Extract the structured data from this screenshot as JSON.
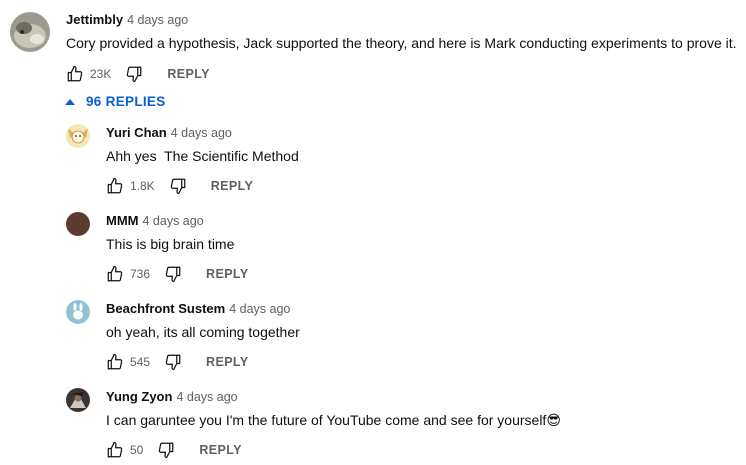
{
  "top_comment": {
    "author": "Jettimbly",
    "time": "4 days ago",
    "text": "Cory provided a hypothesis, Jack supported the theory, and here is Mark conducting experiments to prove it.",
    "likes": "23K",
    "reply_label": "REPLY"
  },
  "replies_toggle": {
    "label": "96 REPLIES"
  },
  "replies": [
    {
      "author": "Yuri Chan",
      "time": "4 days ago",
      "text": "Ahh yes  The Scientific Method",
      "likes": "1.8K",
      "reply_label": "REPLY"
    },
    {
      "author": "MMM",
      "time": "4 days ago",
      "text": "This is big brain time",
      "likes": "736",
      "reply_label": "REPLY"
    },
    {
      "author": "Beachfront Sustem",
      "time": "4 days ago",
      "text": "oh yeah, its all coming together",
      "likes": "545",
      "reply_label": "REPLY"
    },
    {
      "author": "Yung Zyon",
      "time": "4 days ago",
      "text": "I can garuntee you I'm the future of YouTube come and see for yourself",
      "emoji": "😎",
      "likes": "50",
      "reply_label": "REPLY"
    }
  ],
  "colors": {
    "link_blue": "#065fd4",
    "meta_gray": "#606060",
    "mmm_avatar": "#5b3b2e"
  }
}
